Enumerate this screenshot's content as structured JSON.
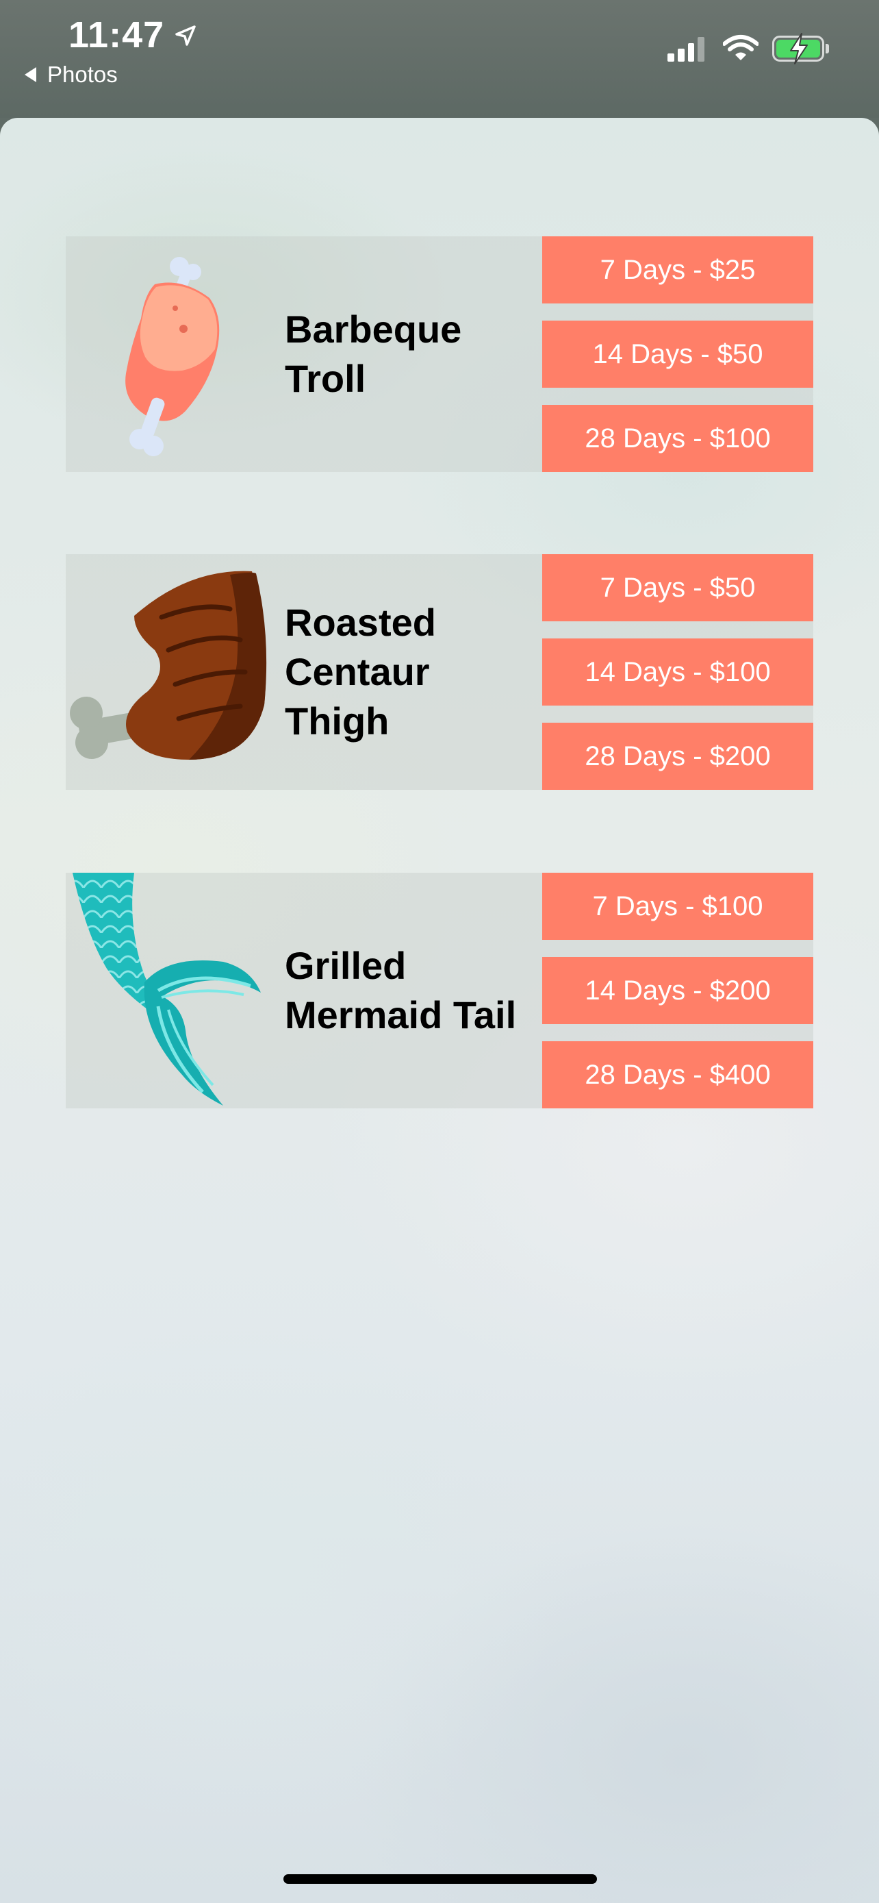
{
  "status_bar": {
    "time": "11:47",
    "back_label": "Photos",
    "battery_color": "#4cd964",
    "icons": [
      "location-arrow-icon",
      "cellular-signal-icon",
      "wifi-icon",
      "battery-charging-icon"
    ]
  },
  "accent_color": "#ff7f68",
  "items": [
    {
      "name": "Barbeque Troll",
      "icon": "meat-drumstick-icon",
      "options": [
        "7 Days - $25",
        "14 Days - $50",
        "28 Days - $100"
      ]
    },
    {
      "name": "Roasted Centaur Thigh",
      "icon": "roasted-leg-icon",
      "options": [
        "7 Days - $50",
        "14 Days - $100",
        "28 Days - $200"
      ]
    },
    {
      "name": "Grilled Mermaid Tail",
      "icon": "mermaid-tail-icon",
      "options": [
        "7 Days - $100",
        "14 Days - $200",
        "28 Days - $400"
      ]
    }
  ]
}
